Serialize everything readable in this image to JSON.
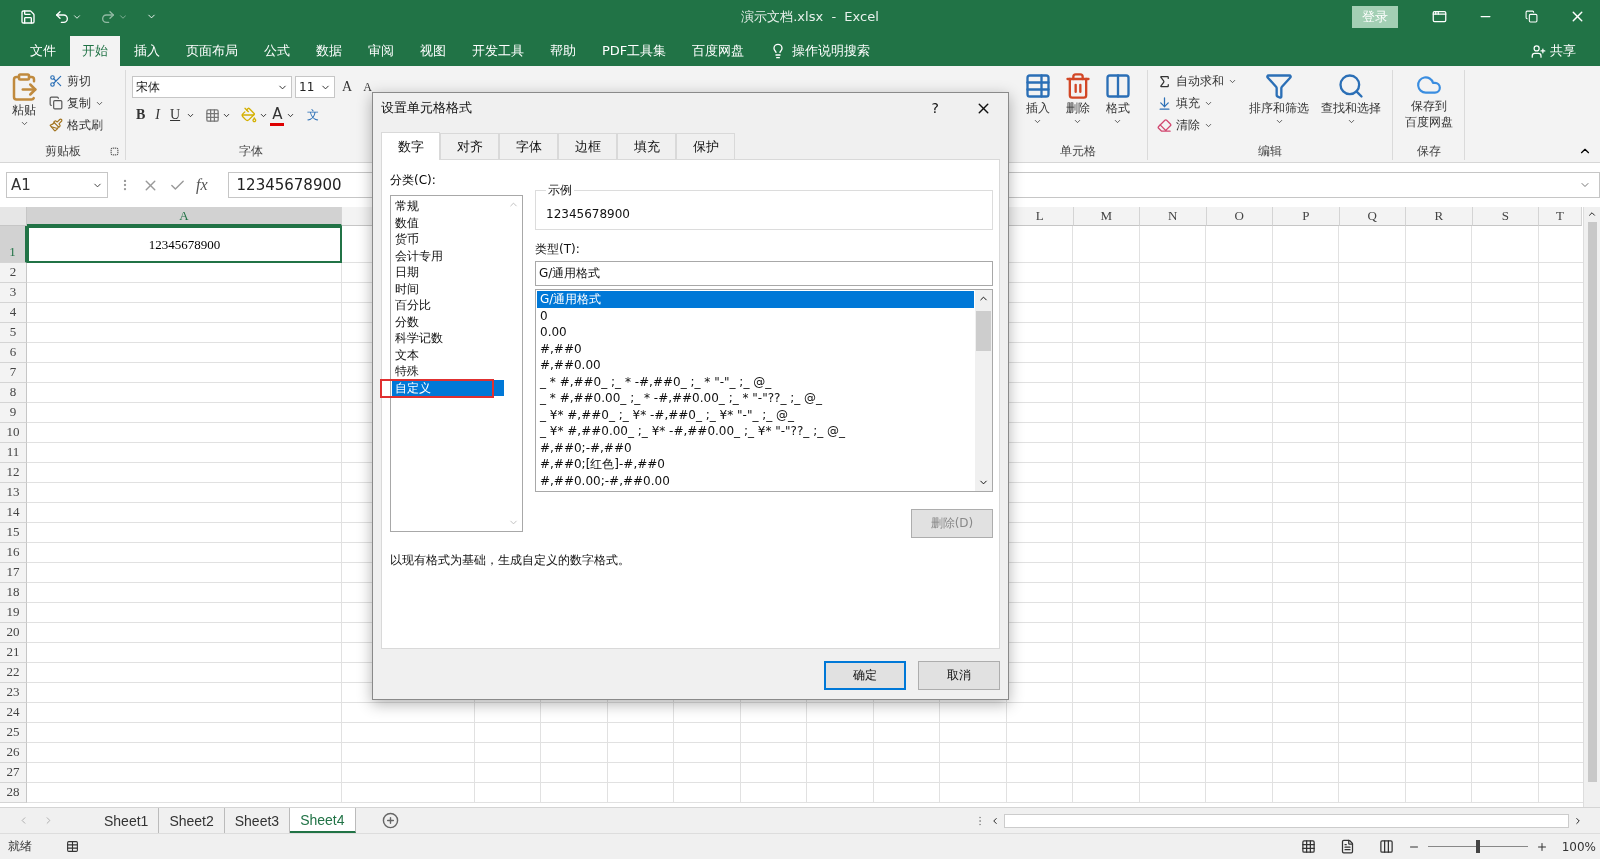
{
  "window": {
    "title": "演示文档.xlsx  -  Excel",
    "sign_in": "登录"
  },
  "menu_tabs": [
    {
      "label": "文件",
      "selected": false
    },
    {
      "label": "开始",
      "selected": true
    },
    {
      "label": "插入",
      "selected": false
    },
    {
      "label": "页面布局",
      "selected": false
    },
    {
      "label": "公式",
      "selected": false
    },
    {
      "label": "数据",
      "selected": false
    },
    {
      "label": "审阅",
      "selected": false
    },
    {
      "label": "视图",
      "selected": false
    },
    {
      "label": "开发工具",
      "selected": false
    },
    {
      "label": "帮助",
      "selected": false
    },
    {
      "label": "PDF工具集",
      "selected": false
    },
    {
      "label": "百度网盘",
      "selected": false
    }
  ],
  "tell_me": "操作说明搜索",
  "share": "共享",
  "ribbon": {
    "clipboard": {
      "paste": "粘贴",
      "cut": "剪切",
      "copy": "复制",
      "format_painter": "格式刷",
      "label": "剪贴板"
    },
    "font": {
      "name": "宋体",
      "size": "11",
      "grow": "A",
      "shrink": "A",
      "styles": [
        "B",
        "I",
        "U"
      ],
      "color_glyph": "A",
      "phonetic": "文",
      "label": "字体"
    },
    "cells": {
      "buttons": [
        "插入",
        "删除",
        "格式"
      ],
      "label": "单元格"
    },
    "editing": {
      "autosum": "自动求和",
      "fill": "填充",
      "clear": "清除",
      "sort": "排序和筛选",
      "find": "查找和选择",
      "label": "编辑"
    },
    "save": {
      "button_lines": [
        "保存到",
        "百度网盘"
      ],
      "label": "保存"
    }
  },
  "formula_bar": {
    "name_box": "A1",
    "function_label": "fx",
    "value": "12345678900"
  },
  "sheet": {
    "columns": [
      {
        "label": "A",
        "selected": true
      },
      {
        "label": "L",
        "selected": false
      },
      {
        "label": "M",
        "selected": false
      },
      {
        "label": "N",
        "selected": false
      },
      {
        "label": "O",
        "selected": false
      },
      {
        "label": "P",
        "selected": false
      },
      {
        "label": "Q",
        "selected": false
      },
      {
        "label": "R",
        "selected": false
      },
      {
        "label": "S",
        "selected": false
      },
      {
        "label": "T",
        "selected": false
      }
    ],
    "rows": [
      {
        "label": "1",
        "selected": true
      },
      {
        "label": "2",
        "selected": false
      },
      {
        "label": "3",
        "selected": false
      },
      {
        "label": "4",
        "selected": false
      },
      {
        "label": "5",
        "selected": false
      },
      {
        "label": "6",
        "selected": false
      },
      {
        "label": "7",
        "selected": false
      },
      {
        "label": "8",
        "selected": false
      },
      {
        "label": "9",
        "selected": false
      },
      {
        "label": "10",
        "selected": false
      },
      {
        "label": "11",
        "selected": false
      },
      {
        "label": "12",
        "selected": false
      },
      {
        "label": "13",
        "selected": false
      },
      {
        "label": "14",
        "selected": false
      },
      {
        "label": "15",
        "selected": false
      },
      {
        "label": "16",
        "selected": false
      },
      {
        "label": "17",
        "selected": false
      },
      {
        "label": "18",
        "selected": false
      },
      {
        "label": "19",
        "selected": false
      },
      {
        "label": "20",
        "selected": false
      },
      {
        "label": "21",
        "selected": false
      },
      {
        "label": "22",
        "selected": false
      },
      {
        "label": "23",
        "selected": false
      },
      {
        "label": "24",
        "selected": false
      },
      {
        "label": "25",
        "selected": false
      },
      {
        "label": "26",
        "selected": false
      },
      {
        "label": "27",
        "selected": false
      },
      {
        "label": "28",
        "selected": false
      }
    ],
    "a1_value": "12345678900"
  },
  "sheet_tabs": [
    {
      "label": "Sheet1",
      "selected": false
    },
    {
      "label": "Sheet2",
      "selected": false
    },
    {
      "label": "Sheet3",
      "selected": false
    },
    {
      "label": "Sheet4",
      "selected": true
    }
  ],
  "status_bar": {
    "status": "就绪",
    "zoom_slider": {
      "level": 0.5
    },
    "zoom_label": "100%"
  },
  "dialog": {
    "title": "设置单元格格式",
    "help": "?",
    "tabs": [
      {
        "label": "数字",
        "selected": true
      },
      {
        "label": "对齐",
        "selected": false
      },
      {
        "label": "字体",
        "selected": false
      },
      {
        "label": "边框",
        "selected": false
      },
      {
        "label": "填充",
        "selected": false
      },
      {
        "label": "保护",
        "selected": false
      }
    ],
    "category_label": "分类(C):",
    "categories": [
      {
        "label": "常规",
        "selected": false
      },
      {
        "label": "数值",
        "selected": false
      },
      {
        "label": "货币",
        "selected": false
      },
      {
        "label": "会计专用",
        "selected": false
      },
      {
        "label": "日期",
        "selected": false
      },
      {
        "label": "时间",
        "selected": false
      },
      {
        "label": "百分比",
        "selected": false
      },
      {
        "label": "分数",
        "selected": false
      },
      {
        "label": "科学记数",
        "selected": false
      },
      {
        "label": "文本",
        "selected": false
      },
      {
        "label": "特殊",
        "selected": false
      },
      {
        "label": "自定义",
        "selected": true,
        "highlighted": true
      }
    ],
    "sample_label": "示例",
    "sample_value": "12345678900",
    "type_label": "类型(T):",
    "type_value": "G/通用格式",
    "formats": [
      {
        "label": "G/通用格式",
        "selected": true
      },
      {
        "label": "0",
        "selected": false
      },
      {
        "label": "0.00",
        "selected": false
      },
      {
        "label": "#,##0",
        "selected": false
      },
      {
        "label": "#,##0.00",
        "selected": false
      },
      {
        "label": "_ * #,##0_ ;_ * -#,##0_ ;_ * \"-\"_ ;_ @_",
        "selected": false
      },
      {
        "label": "_ * #,##0.00_ ;_ * -#,##0.00_ ;_ * \"-\"??_ ;_ @_",
        "selected": false
      },
      {
        "label": "_ ¥* #,##0_ ;_ ¥* -#,##0_ ;_ ¥* \"-\"_ ;_ @_",
        "selected": false
      },
      {
        "label": "_ ¥* #,##0.00_ ;_ ¥* -#,##0.00_ ;_ ¥* \"-\"??_ ;_ @_",
        "selected": false
      },
      {
        "label": "#,##0;-#,##0",
        "selected": false
      },
      {
        "label": "#,##0;[红色]-#,##0",
        "selected": false
      },
      {
        "label": "#,##0.00;-#,##0.00",
        "selected": false
      }
    ],
    "delete_button": {
      "label": "删除(D)",
      "disabled": true
    },
    "description": "以现有格式为基础，生成自定义的数字格式。",
    "ok": "确定",
    "cancel": "取消"
  }
}
